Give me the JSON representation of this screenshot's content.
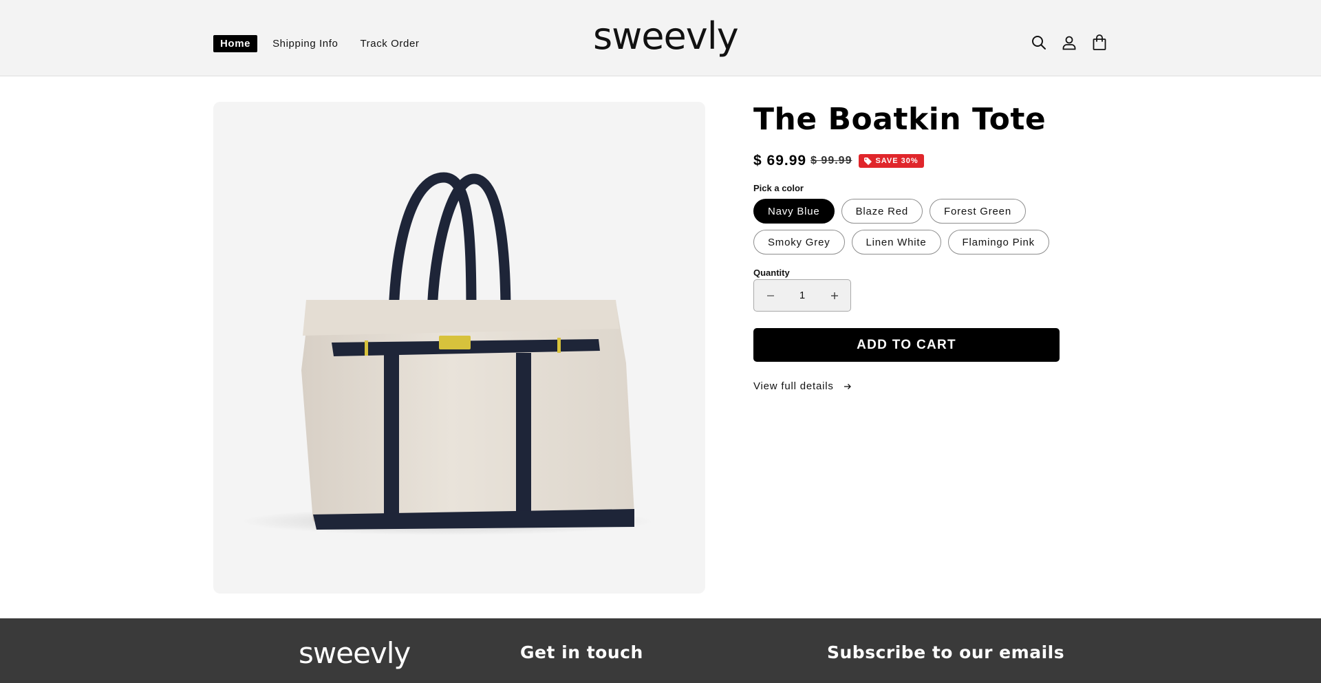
{
  "header": {
    "nav": [
      {
        "label": "Home",
        "active": true
      },
      {
        "label": "Shipping Info",
        "active": false
      },
      {
        "label": "Track Order",
        "active": false
      }
    ],
    "logo": "sweevly",
    "icons": [
      "search-icon",
      "account-icon",
      "cart-icon"
    ]
  },
  "product": {
    "title": "The Boatkin Tote",
    "price": "$ 69.99",
    "compare_price": "$ 99.99",
    "save_badge": "SAVE 30%",
    "color_label": "Pick a color",
    "colors": [
      {
        "label": "Navy Blue",
        "selected": true
      },
      {
        "label": "Blaze Red",
        "selected": false
      },
      {
        "label": "Forest Green",
        "selected": false
      },
      {
        "label": "Smoky Grey",
        "selected": false
      },
      {
        "label": "Linen White",
        "selected": false
      },
      {
        "label": "Flamingo Pink",
        "selected": false
      }
    ],
    "quantity_label": "Quantity",
    "quantity": "1",
    "add_to_cart": "ADD TO CART",
    "view_details": "View full details",
    "image_alt": "Canvas tote bag with navy blue straps and gold buckle"
  },
  "footer": {
    "logo": "sweevly",
    "contact_heading": "Get in touch",
    "subscribe_heading": "Subscribe to our emails"
  },
  "colors": {
    "accent": "#000000",
    "sale_badge": "#e0262b",
    "header_bg": "#f3f3f3",
    "footer_bg": "#3a3a3a"
  }
}
